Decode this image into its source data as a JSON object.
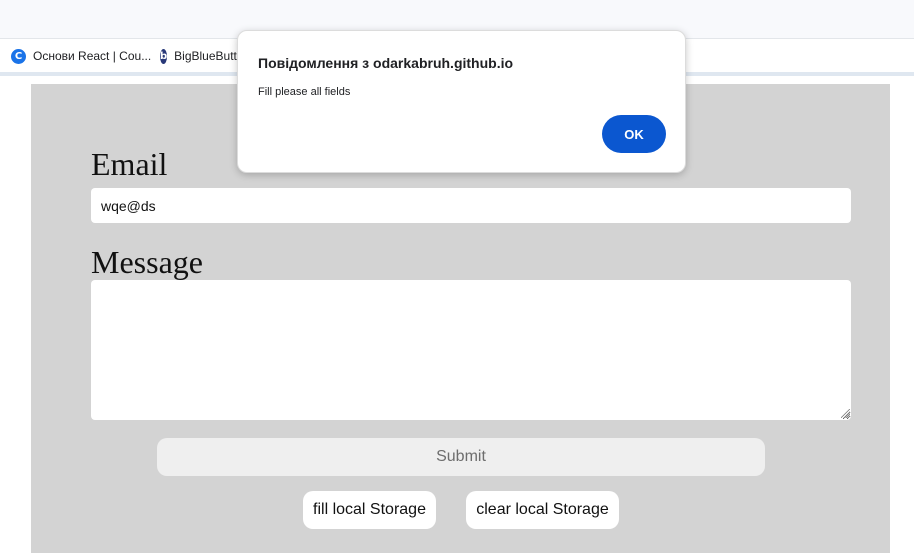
{
  "browser": {
    "bookmarks": [
      {
        "label": "Основи React | Cou...",
        "icon": "c-logo-icon",
        "icon_glyph": "C"
      },
      {
        "label": "BigBlueButton",
        "icon": "bigbluebutton-icon",
        "icon_glyph": "b"
      }
    ]
  },
  "form": {
    "email_label": "Email",
    "email_value": "wqe@ds",
    "message_label": "Message",
    "message_value": "",
    "submit_label": "Submit",
    "fill_storage_label": "fill local Storage",
    "clear_storage_label": "clear local Storage"
  },
  "alert": {
    "title": "Повідомлення з odarkabruh.github.io",
    "message": "Fill please all fields",
    "ok_label": "OK"
  },
  "colors": {
    "panel_bg": "#d3d3d3",
    "ok_button": "#0b57d0",
    "submit_bg": "#efefef"
  }
}
